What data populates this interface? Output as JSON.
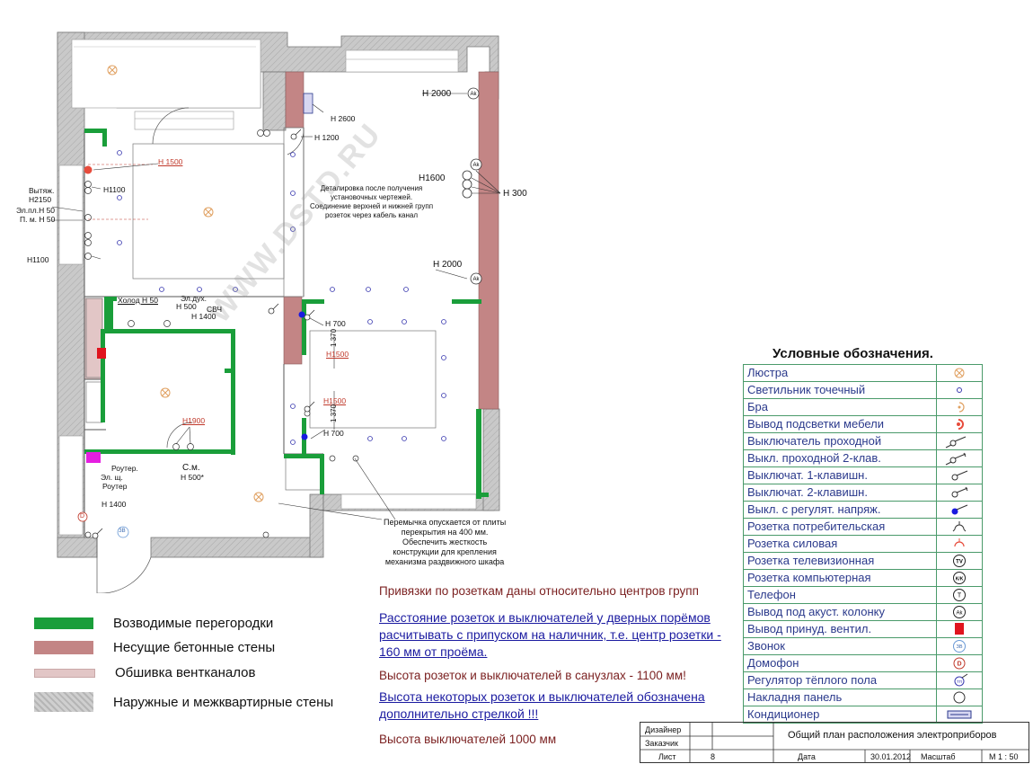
{
  "watermark": "WWW.DSTD.RU",
  "legend": {
    "title": "Условные обозначения.",
    "items": [
      {
        "label": "Люстра",
        "icon": "chandelier-icon"
      },
      {
        "label": "Светильник точечный",
        "icon": "spotlight-icon"
      },
      {
        "label": "Бра",
        "icon": "sconce-icon"
      },
      {
        "label": "Вывод подсветки мебели",
        "icon": "furniture-light-icon"
      },
      {
        "label": "Выключатель проходной",
        "icon": "pass-switch-icon"
      },
      {
        "label": "Выкл. проходной 2-клав.",
        "icon": "pass-switch-2key-icon"
      },
      {
        "label": "Выключат. 1-клавишн.",
        "icon": "switch-1key-icon"
      },
      {
        "label": "Выключат. 2-клавишн.",
        "icon": "switch-2key-icon"
      },
      {
        "label": "Выкл. с регулят. напряж.",
        "icon": "dimmer-switch-icon"
      },
      {
        "label": "Розетка потребительская",
        "icon": "outlet-icon"
      },
      {
        "label": "Розетка силовая",
        "icon": "power-outlet-icon"
      },
      {
        "label": "Розетка телевизионная",
        "icon": "tv-outlet-icon"
      },
      {
        "label": "Розетка компьютерная",
        "icon": "computer-outlet-icon"
      },
      {
        "label": "Телефон",
        "icon": "telephone-icon"
      },
      {
        "label": "Вывод под акуст. колонку",
        "icon": "speaker-icon"
      },
      {
        "label": "Вывод принуд. вентил.",
        "icon": "ventilation-icon"
      },
      {
        "label": "Звонок",
        "icon": "doorbell-icon"
      },
      {
        "label": "Домофон",
        "icon": "intercom-icon"
      },
      {
        "label": "Регулятор тёплого пола",
        "icon": "floor-heating-icon"
      },
      {
        "label": "Накладня панель",
        "icon": "panel-icon"
      },
      {
        "label": "Кондиционер",
        "icon": "air-conditioner-icon"
      }
    ],
    "symbols": {
      "tv": "TV",
      "kk": "K/K",
      "t": "T",
      "ak": "Ak",
      "d": "D",
      "zv": "ЗВ",
      "tp": "ТП"
    }
  },
  "wall_key": [
    {
      "label": "Возводимые перегородки",
      "color": "#1a9e3a"
    },
    {
      "label": "Несущие бетонные  стены",
      "color": "#c38585"
    },
    {
      "label": "Обшивка вентканалов",
      "color": "#e2c6c6"
    },
    {
      "label": "Наружные и межквартирные стены",
      "color": "#c8c8c8"
    }
  ],
  "notes": [
    {
      "text": "Привязки по розеткам даны относительно центров групп",
      "style": "red"
    },
    {
      "text": "Расстояние розеток и выключателей у дверных порёмов",
      "style": "blue"
    },
    {
      "text": "расчитывать с припуском на наличник, т.е. центр розетки -",
      "style": "blue"
    },
    {
      "text": "160 мм от проёма.",
      "style": "blue"
    },
    {
      "text": "Высота розеток и выключателей  в санузлах - 1100 мм!",
      "style": "red"
    },
    {
      "text": "Высота некоторых розеток  и выключателей обозначена",
      "style": "blue"
    },
    {
      "text": "дополнительно стрелкой !!!",
      "style": "blue"
    },
    {
      "text": "Высота выключателей 1000 мм",
      "style": "red"
    }
  ],
  "title_block": {
    "designer_label": "Дизайнер",
    "customer_label": "Заказчик",
    "sheet_label": "Лист",
    "sheet_value": "8",
    "title": "Общий план расположения электроприборов",
    "date_label": "Дата",
    "date_value": "30.01.2012",
    "scale_label": "Масштаб",
    "scale_value": "М 1 : 50"
  },
  "plan_labels": {
    "h2000a": "H 2000",
    "h2600": "H 2600",
    "h1200": "H 1200",
    "h1500a": "H 1500",
    "h1100a": "H1100",
    "vytyazh": "Вытяж.",
    "h2150": "H2150",
    "elpl": "Эл.пл.H 50",
    "pm": "П. м. H 50",
    "h1100b": "H1100",
    "h1600": "H1600",
    "h300": "H 300",
    "detail1": "Деталировка после получения",
    "detail2": "установочных чертежей.",
    "detail3": "Соединение верхней и нижней групп",
    "detail4": "розеток через кабель канал",
    "h2000b": "H 2000",
    "holod": "Холод H 50",
    "elduh": "Эл.дух.",
    "h500a": "H 500",
    "svch": "СВЧ",
    "h1400a": "H 1400",
    "h700a": "H 700",
    "h1500b": "H1500",
    "dim1370a": "1 370",
    "h1500c": "H1500",
    "dim1370b": "1 370",
    "h700b": "H 700",
    "h1900": "H1900",
    "sm": "С.м.",
    "h500b": "H 500*",
    "router1": "Роутер.",
    "elsch": "Эл. щ.",
    "router2": "Роутер",
    "h1400b": "H 1400",
    "zv": "ЗВ",
    "d": "D"
  },
  "callout": {
    "line1": "Перемычка опускается от плиты",
    "line2": "перекрытия на 400 мм.",
    "line3": "Обеспечить жесткость",
    "line4": "конструкции для крепления",
    "line5": "механизма раздвижного шкафа"
  },
  "colors": {
    "partition": "#1a9e3a",
    "bearing_wall": "#c38585",
    "vent_cladding": "#e2c6c6",
    "outer_wall": "#c8c8c8",
    "legend_border": "#4a9a6a",
    "legend_text": "#2b3a8c"
  }
}
